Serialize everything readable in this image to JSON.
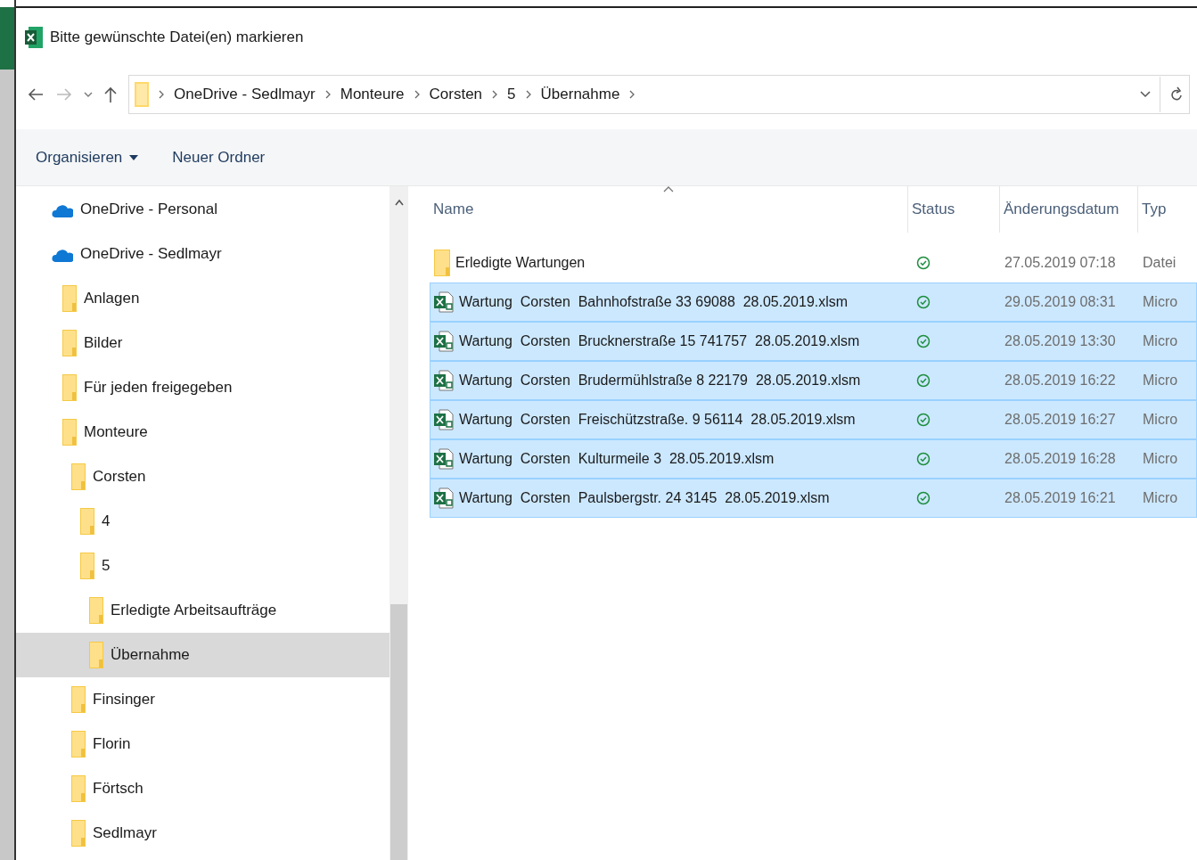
{
  "window": {
    "title": "Bitte gewünschte Datei(en) markieren"
  },
  "address": {
    "crumbs": [
      "OneDrive - Sedlmayr",
      "Monteure",
      "Corsten",
      "5",
      "Übernahme"
    ]
  },
  "toolbar": [
    {
      "label": "Organisieren",
      "dropdown": true
    },
    {
      "label": "Neuer Ordner",
      "dropdown": false
    }
  ],
  "nav_tree": [
    {
      "label": "OneDrive - Personal",
      "kind": "cloud",
      "selected": false
    },
    {
      "label": "OneDrive - Sedlmayr",
      "kind": "cloud",
      "selected": false,
      "children": [
        {
          "label": "Anlagen",
          "kind": "folder",
          "selected": false
        },
        {
          "label": "Bilder",
          "kind": "folder",
          "selected": false
        },
        {
          "label": "Für jeden freigegeben",
          "kind": "folder",
          "selected": false
        },
        {
          "label": "Monteure",
          "kind": "folder",
          "selected": false,
          "children": [
            {
              "label": "Corsten",
              "kind": "folder",
              "selected": false,
              "children": [
                {
                  "label": "4",
                  "kind": "folder",
                  "selected": false
                },
                {
                  "label": "5",
                  "kind": "folder",
                  "selected": false,
                  "children": [
                    {
                      "label": "Erledigte Arbeitsaufträge",
                      "kind": "folder",
                      "selected": false
                    },
                    {
                      "label": "Übernahme",
                      "kind": "folder",
                      "selected": true
                    }
                  ]
                }
              ]
            },
            {
              "label": "Finsinger",
              "kind": "folder",
              "selected": false
            },
            {
              "label": "Florin",
              "kind": "folder",
              "selected": false
            },
            {
              "label": "Förtsch",
              "kind": "folder",
              "selected": false
            },
            {
              "label": "Sedlmayr",
              "kind": "folder",
              "selected": false
            }
          ]
        }
      ]
    }
  ],
  "file_list": {
    "columns": [
      "Name",
      "Status",
      "Änderungsdatum",
      "Typ"
    ],
    "rows": [
      {
        "kind": "folder",
        "name": "Erledigte Wartungen",
        "date": "27.05.2019 07:18",
        "type": "Datei",
        "selected": false
      },
      {
        "kind": "excel",
        "name": "Wartung  Corsten  Bahnhofstraße 33 69088  28.05.2019.xlsm",
        "date": "29.05.2019 08:31",
        "type": "Micro",
        "selected": true
      },
      {
        "kind": "excel",
        "name": "Wartung  Corsten  Brucknerstraße 15 741757  28.05.2019.xlsm",
        "date": "28.05.2019 13:30",
        "type": "Micro",
        "selected": true
      },
      {
        "kind": "excel",
        "name": "Wartung  Corsten  Brudermühlstraße 8 22179  28.05.2019.xlsm",
        "date": "28.05.2019 16:22",
        "type": "Micro",
        "selected": true
      },
      {
        "kind": "excel",
        "name": "Wartung  Corsten  Freischützstraße. 9 56114  28.05.2019.xlsm",
        "date": "28.05.2019 16:27",
        "type": "Micro",
        "selected": true
      },
      {
        "kind": "excel",
        "name": "Wartung  Corsten  Kulturmeile 3  28.05.2019.xlsm",
        "date": "28.05.2019 16:28",
        "type": "Micro",
        "selected": true
      },
      {
        "kind": "excel",
        "name": "Wartung  Corsten  Paulsbergstr. 24 3145  28.05.2019.xlsm",
        "date": "28.05.2019 16:21",
        "type": "Micro",
        "selected": true
      }
    ]
  }
}
